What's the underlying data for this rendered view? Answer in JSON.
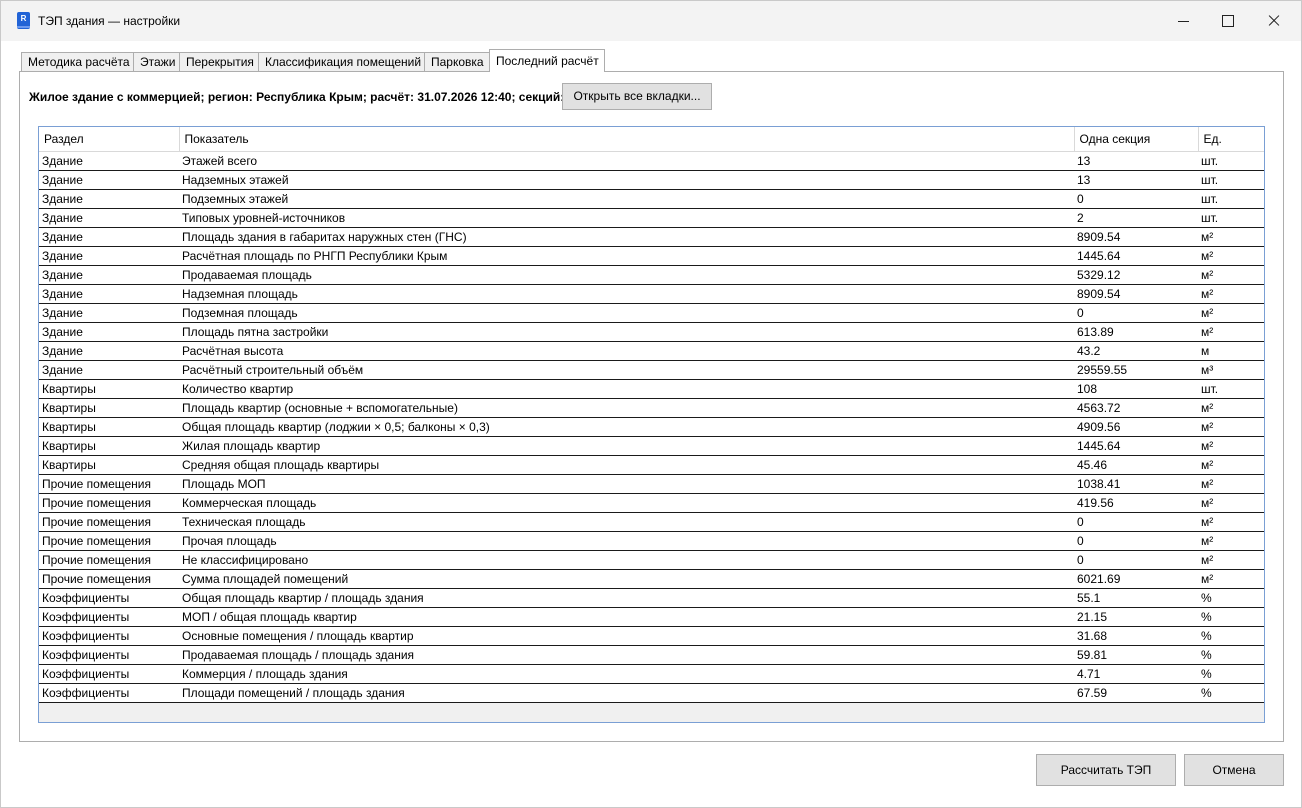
{
  "window": {
    "title": "ТЭП здания — настройки",
    "app_icon_letter": "R"
  },
  "tabs": [
    {
      "label": "Методика расчёта"
    },
    {
      "label": "Этажи"
    },
    {
      "label": "Перекрытия"
    },
    {
      "label": "Классификация помещений"
    },
    {
      "label": "Парковка"
    },
    {
      "label": "Последний расчёт"
    }
  ],
  "active_tab": "Последний расчёт",
  "info_text": "Жилое здание с коммерцией; регион: Республика Крым; расчёт: 31.07.2026 12:40; секций: 1",
  "open_all_button": "Открыть все вкладки...",
  "table": {
    "headers": [
      "Раздел",
      "Показатель",
      "Одна секция",
      "Ед."
    ],
    "rows": [
      [
        "Здание",
        "Этажей всего",
        "13",
        "шт."
      ],
      [
        "Здание",
        "Надземных этажей",
        "13",
        "шт."
      ],
      [
        "Здание",
        "Подземных этажей",
        "0",
        "шт."
      ],
      [
        "Здание",
        "Типовых уровней-источников",
        "2",
        "шт."
      ],
      [
        "Здание",
        "Площадь здания в габаритах наружных стен (ГНС)",
        "8909.54",
        "м²"
      ],
      [
        "Здание",
        "Расчётная площадь по РНГП Республики Крым",
        "1445.64",
        "м²"
      ],
      [
        "Здание",
        "Продаваемая площадь",
        "5329.12",
        "м²"
      ],
      [
        "Здание",
        "Надземная площадь",
        "8909.54",
        "м²"
      ],
      [
        "Здание",
        "Подземная площадь",
        "0",
        "м²"
      ],
      [
        "Здание",
        "Площадь пятна застройки",
        "613.89",
        "м²"
      ],
      [
        "Здание",
        "Расчётная высота",
        "43.2",
        "м"
      ],
      [
        "Здание",
        "Расчётный строительный объём",
        "29559.55",
        "м³"
      ],
      [
        "Квартиры",
        "Количество квартир",
        "108",
        "шт."
      ],
      [
        "Квартиры",
        "Площадь квартир (основные + вспомогательные)",
        "4563.72",
        "м²"
      ],
      [
        "Квартиры",
        "Общая площадь квартир (лоджии × 0,5; балконы × 0,3)",
        "4909.56",
        "м²"
      ],
      [
        "Квартиры",
        "Жилая площадь квартир",
        "1445.64",
        "м²"
      ],
      [
        "Квартиры",
        "Средняя общая площадь квартиры",
        "45.46",
        "м²"
      ],
      [
        "Прочие помещения",
        "Площадь МОП",
        "1038.41",
        "м²"
      ],
      [
        "Прочие помещения",
        "Коммерческая площадь",
        "419.56",
        "м²"
      ],
      [
        "Прочие помещения",
        "Техническая площадь",
        "0",
        "м²"
      ],
      [
        "Прочие помещения",
        "Прочая площадь",
        "0",
        "м²"
      ],
      [
        "Прочие помещения",
        "Не классифицировано",
        "0",
        "м²"
      ],
      [
        "Прочие помещения",
        "Сумма площадей помещений",
        "6021.69",
        "м²"
      ],
      [
        "Коэффициенты",
        "Общая площадь квартир / площадь здания",
        "55.1",
        "%"
      ],
      [
        "Коэффициенты",
        "МОП / общая площадь квартир",
        "21.15",
        "%"
      ],
      [
        "Коэффициенты",
        "Основные помещения / площадь квартир",
        "31.68",
        "%"
      ],
      [
        "Коэффициенты",
        "Продаваемая площадь / площадь здания",
        "59.81",
        "%"
      ],
      [
        "Коэффициенты",
        "Коммерция / площадь здания",
        "4.71",
        "%"
      ],
      [
        "Коэффициенты",
        "Площади помещений / площадь здания",
        "67.59",
        "%"
      ]
    ]
  },
  "footer": {
    "calculate_button": "Рассчитать ТЭП",
    "cancel_button": "Отмена"
  },
  "colors": {
    "grid_border": "#7a9fd4",
    "button_face": "#e1e1e1",
    "titlebar": "#f3f3f3"
  }
}
